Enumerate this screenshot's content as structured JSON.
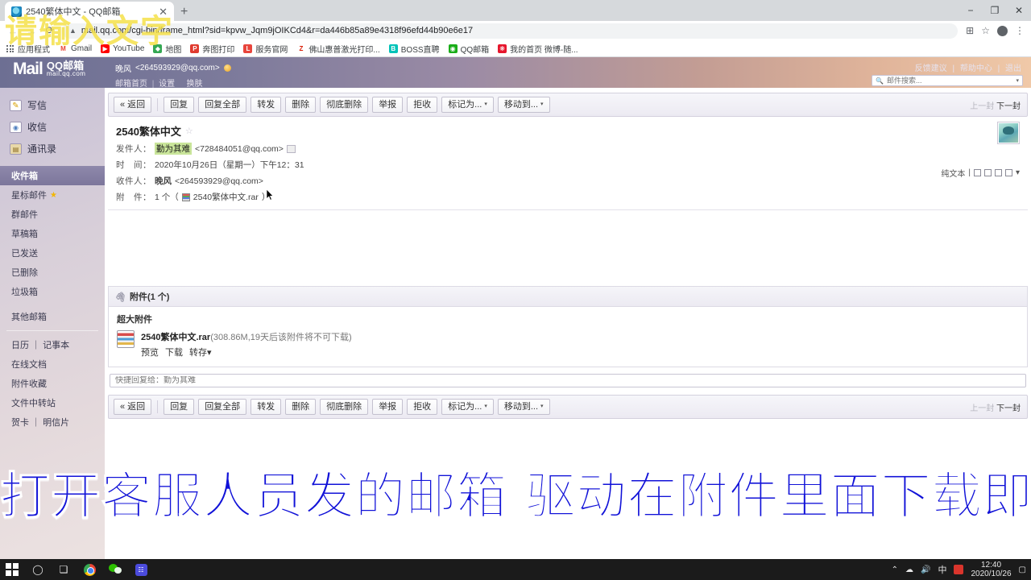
{
  "browser": {
    "tab": {
      "title": "2540繁体中文 - QQ邮箱",
      "close": "✕",
      "favicon": "qqmail-favicon"
    },
    "new_tab": "+",
    "window_controls": {
      "minimize": "−",
      "maximize": "❐",
      "close": "✕"
    },
    "nav": {
      "back": "←",
      "forward": "→",
      "reload": "⟳"
    },
    "url": "mail.qq.com/cgi-bin/frame_html?sid=kpvw_Jqm9jOIKCd4&r=da446b85a89e4318f96efd44b90e6e17",
    "omni_icons": {
      "translate": "⊞",
      "bookmark": "☆",
      "profile": "account-avatar",
      "menu": "⋮"
    },
    "bookmarks": [
      {
        "label": "应用程式",
        "icon": "apps-grid-icon",
        "color": "#5f6368"
      },
      {
        "label": "Gmail",
        "icon": "gmail-icon",
        "color": "#ea4335",
        "glyph": "M"
      },
      {
        "label": "YouTube",
        "icon": "youtube-icon",
        "color": "#ff0000",
        "glyph": "▶"
      },
      {
        "label": "地图",
        "icon": "maps-icon",
        "color": "#34a853",
        "glyph": "◆"
      },
      {
        "label": "奔图打印",
        "icon": "pantum-icon",
        "color": "#e03b2f",
        "glyph": "P"
      },
      {
        "label": "服务官网",
        "icon": "service-icon",
        "color": "#e8453c",
        "glyph": "L"
      },
      {
        "label": "佛山惠普激光打印...",
        "icon": "zhihu-icon",
        "color": "#ffffff",
        "glyph": "Z",
        "fg": "#d81e06"
      },
      {
        "label": "BOSS直聘",
        "icon": "boss-icon",
        "color": "#00c2b8",
        "glyph": "B"
      },
      {
        "label": "QQ邮箱",
        "icon": "qqmail-icon",
        "color": "#1aad19",
        "glyph": "◉"
      },
      {
        "label": "我的首页 微博-随...",
        "icon": "weibo-icon",
        "color": "#e6162d",
        "glyph": "❋"
      }
    ]
  },
  "qqmail": {
    "logo": {
      "mail": "Mail",
      "cn": "QQ邮箱",
      "domain": "mail.qq.com"
    },
    "account": {
      "name": "晚风",
      "address": "<264593929@qq.com>",
      "vip_badge": "vip-crown-icon"
    },
    "account_links": [
      "邮箱首页",
      "设置",
      "换肤"
    ],
    "top_right_links": [
      "反馈建议",
      "帮助中心",
      "退出"
    ],
    "search": {
      "placeholder": "邮件搜索...",
      "icon": "search-icon",
      "caret": "▾"
    },
    "sidebar": {
      "primary": [
        {
          "label": "写信",
          "icon": "compose-icon"
        },
        {
          "label": "收信",
          "icon": "receive-icon"
        },
        {
          "label": "通讯录",
          "icon": "contacts-icon"
        }
      ],
      "folders": [
        {
          "label": "收件箱",
          "active": true
        },
        {
          "label": "星标邮件",
          "star": "★"
        },
        {
          "label": "群邮件"
        },
        {
          "label": "草稿箱"
        },
        {
          "label": "已发送"
        },
        {
          "label": "已删除"
        },
        {
          "label": "垃圾箱"
        }
      ],
      "other": {
        "label": "其他邮箱"
      },
      "tools": [
        {
          "label": "日历 ｜ 记事本"
        },
        {
          "label": "在线文档"
        },
        {
          "label": "附件收藏"
        },
        {
          "label": "文件中转站"
        },
        {
          "label": "贺卡 ｜ 明信片"
        }
      ]
    },
    "toolbar": {
      "back": "« 返回",
      "buttons": [
        "回复",
        "回复全部",
        "转发",
        "删除",
        "彻底删除",
        "举报",
        "拒收"
      ],
      "dropdowns": [
        {
          "label": "标记为...",
          "caret": "▾"
        },
        {
          "label": "移动到...",
          "caret": "▾"
        }
      ],
      "pager": {
        "prev": "上一封",
        "next": "下一封"
      }
    },
    "mail": {
      "subject": "2540繁体中文",
      "star": "☆",
      "from_label": "发件人：",
      "from_name": "勤为其难",
      "from_addr": "<728484051@qq.com>",
      "from_tag": "contact-tag-icon",
      "time_label": "时　间：",
      "time_value": "2020年10月26日（星期一）下午12：31",
      "to_label": "收件人：",
      "to_name": "晚风",
      "to_addr": "<264593929@qq.com>",
      "att_label": "附　件：",
      "att_value": "1 个（",
      "att_name": "2540繁体中文.rar",
      "att_value_end": "）",
      "view_mode": "纯文本",
      "avatar": "sender-avatar"
    },
    "attachments": {
      "header": "附件(1 个)",
      "clip_icon": "paperclip-icon",
      "group_title": "超大附件",
      "file": {
        "name": "2540繁体中文.rar",
        "meta": "(308.86M,19天后该附件将不可下载)",
        "icon": "rar-file-icon",
        "actions": [
          {
            "label": "预览"
          },
          {
            "label": "下载"
          },
          {
            "label": "转存",
            "caret": "▾"
          }
        ]
      }
    },
    "quick_reply": {
      "placeholder": "快捷回复给：勤为其难"
    }
  },
  "overlays": {
    "watermark": "请输入文字",
    "subtitle": "打开客服人员发的邮箱 驱动在附件里面下载即可"
  },
  "taskbar": {
    "start": "windows-start-icon",
    "search": "cortana-search-icon",
    "taskview": "task-view-icon",
    "apps": [
      "chrome-icon",
      "wechat-icon",
      "qq-app-icon"
    ],
    "tray": {
      "caret": "⌃",
      "ime": "中",
      "time": "12:40",
      "date": "2020/10/26",
      "notification": "▢"
    }
  }
}
